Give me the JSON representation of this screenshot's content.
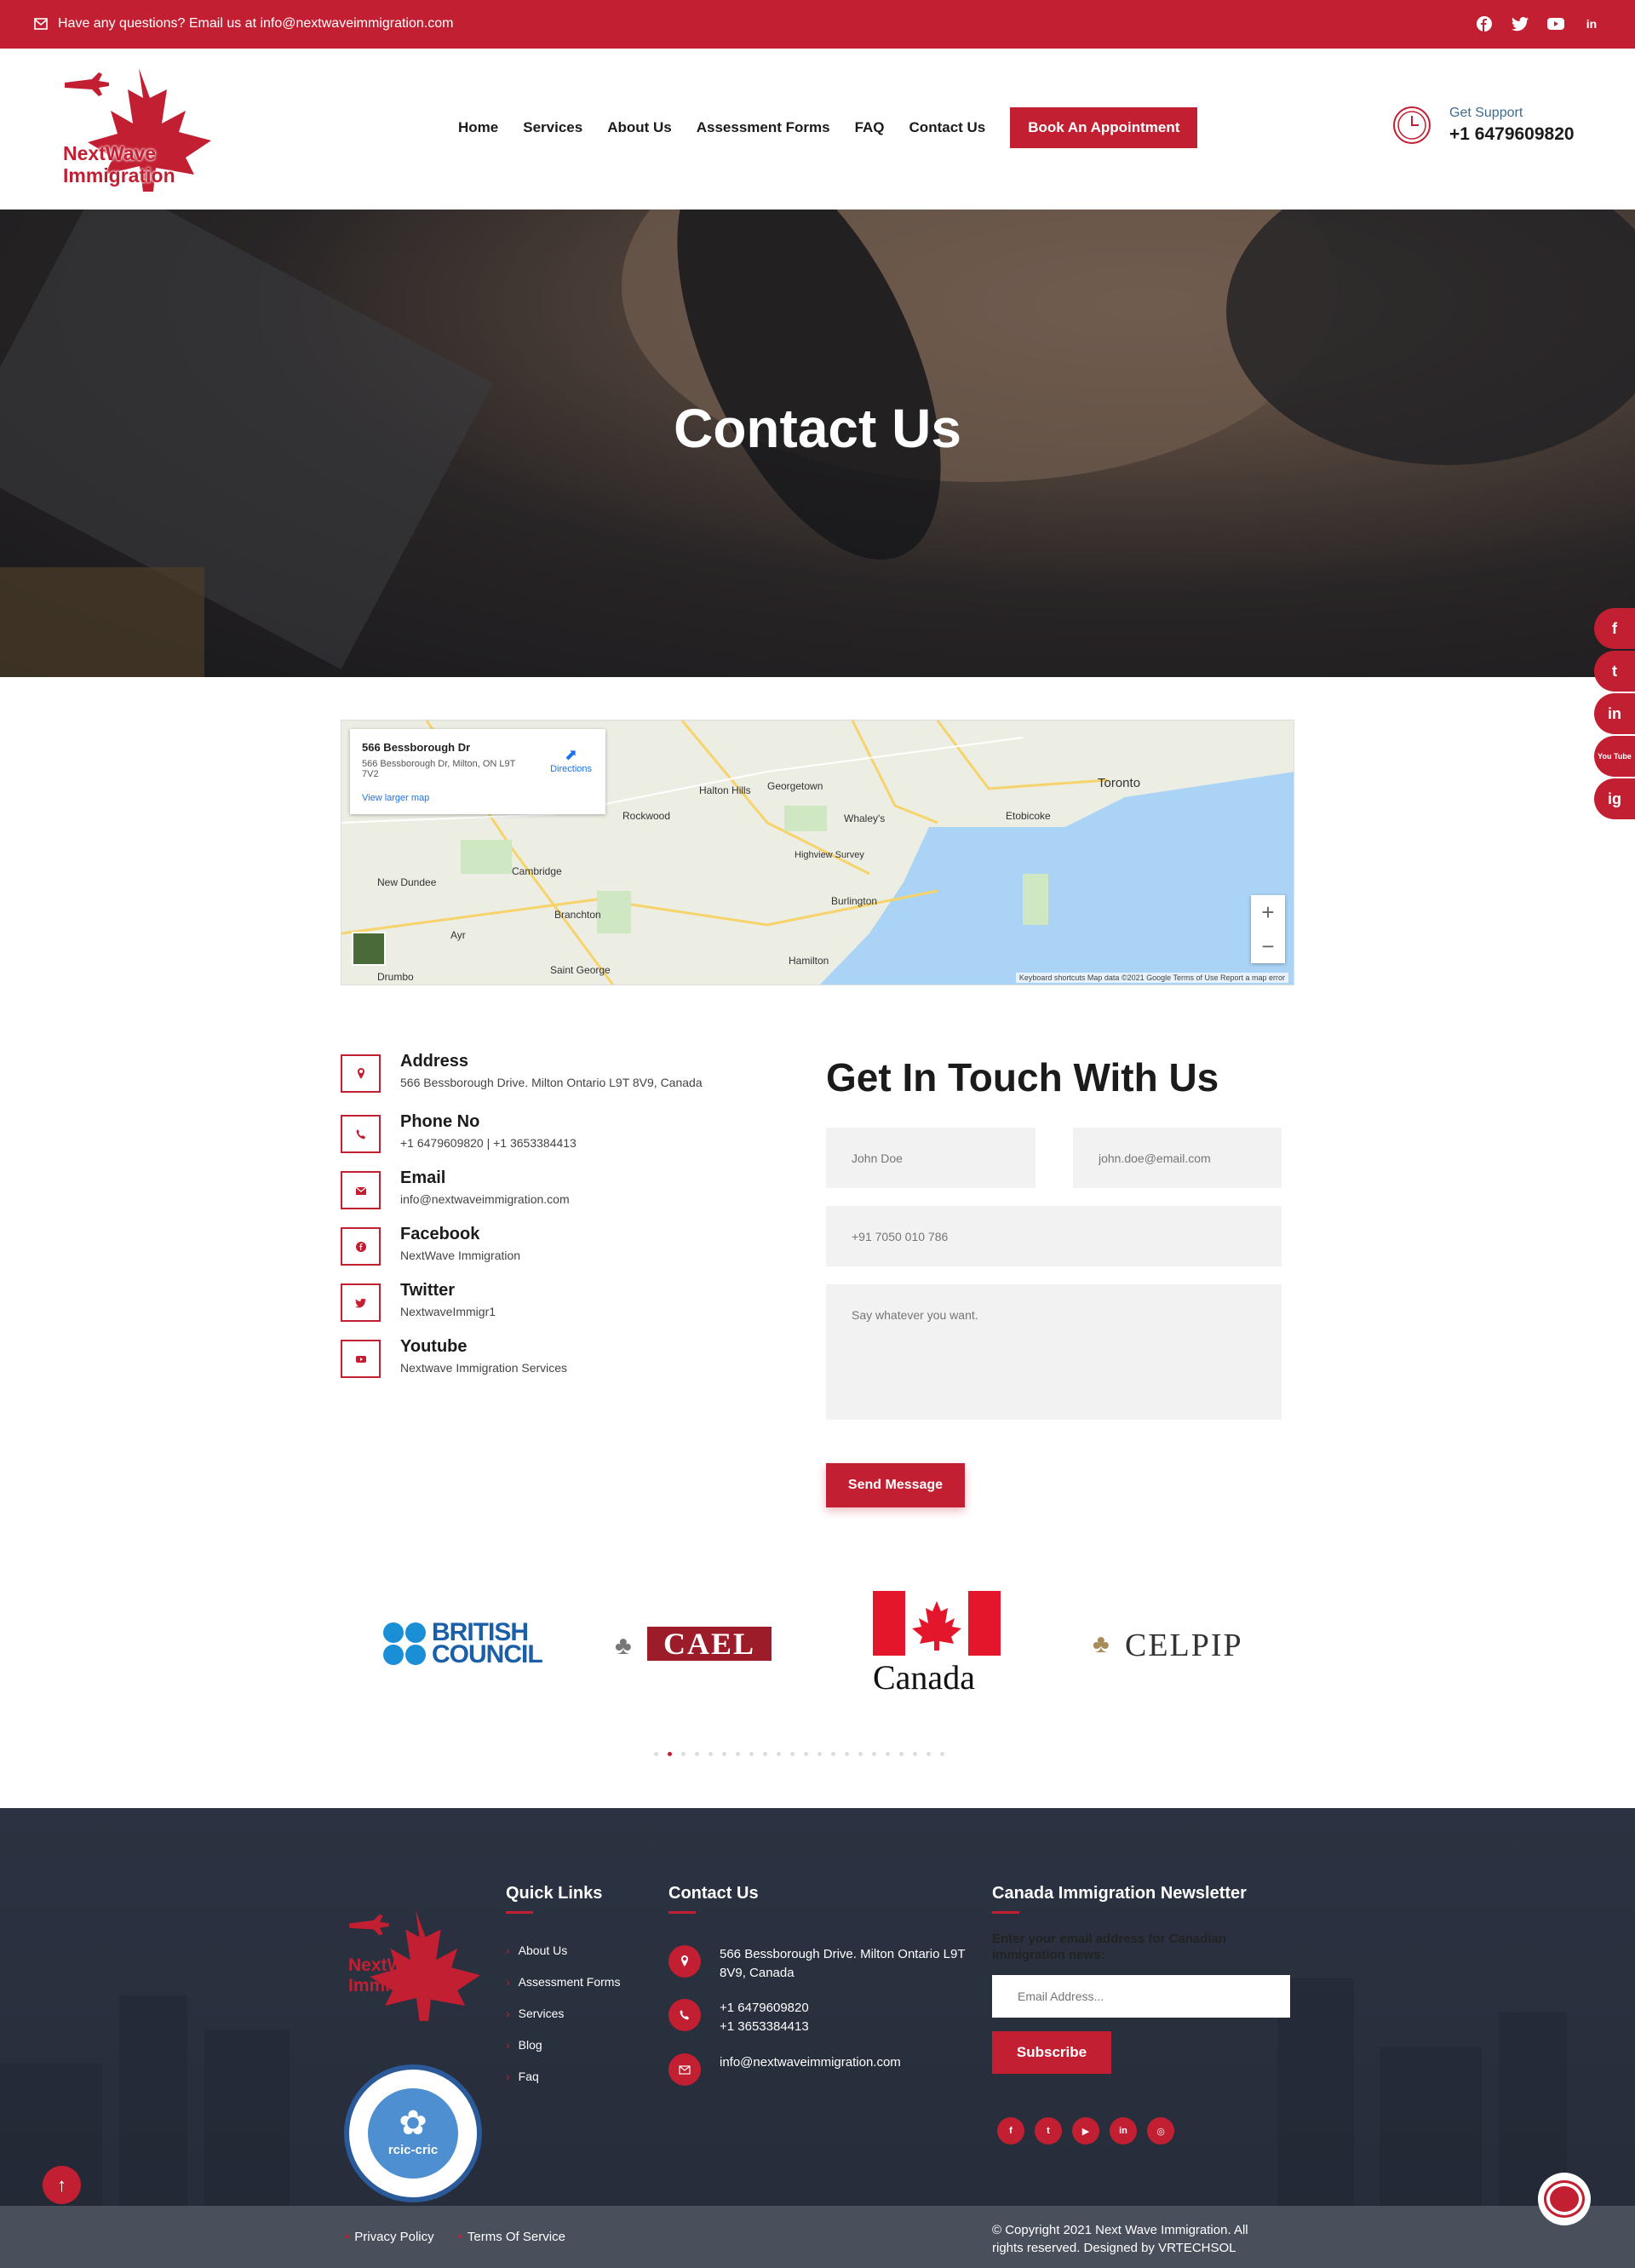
{
  "topbar": {
    "email_text": "Have any questions? Email us at info@nextwaveimmigration.com",
    "social_icons": [
      "facebook-icon",
      "twitter-icon",
      "youtube-icon",
      "linkedin-icon"
    ]
  },
  "header": {
    "logo_line1": "NextWave",
    "logo_line2": "Immigration",
    "nav": [
      "Home",
      "Services",
      "About Us",
      "Assessment Forms",
      "FAQ",
      "Contact Us"
    ],
    "cta": "Book An Appointment",
    "support_label": "Get Support",
    "support_number": "+1 6479609820"
  },
  "hero": {
    "title": "Contact Us"
  },
  "map": {
    "place_title": "566 Bessborough Dr",
    "place_address": "566 Bessborough Dr, Milton, ON L9T 7V2",
    "directions": "Directions",
    "larger_map": "View larger map",
    "cities": [
      "Toronto",
      "Burlington",
      "Cambridge",
      "Halton Hills",
      "Brampton",
      "Etobicoke",
      "Hamilton",
      "New Dundee",
      "Rockwood",
      "Whaley's",
      "Georgetown",
      "Ayr",
      "Branchton",
      "Saint George",
      "Drumbo",
      "Highview Survey"
    ],
    "footer_text": "Keyboard shortcuts   Map data ©2021 Google   Terms of Use   Report a map error"
  },
  "contact": {
    "items": [
      {
        "label": "Address",
        "value": "566 Bessborough Drive. Milton Ontario L9T 8V9, Canada",
        "icon": "location-icon"
      },
      {
        "label": "Phone No",
        "value": "+1 6479609820 | +1 3653384413",
        "icon": "phone-icon"
      },
      {
        "label": "Email",
        "value": "info@nextwaveimmigration.com",
        "icon": "envelope-icon"
      },
      {
        "label": "Facebook",
        "value": "NextWave Immigration",
        "icon": "facebook-icon"
      },
      {
        "label": "Twitter",
        "value": "NextwaveImmigr1",
        "icon": "twitter-icon"
      },
      {
        "label": "Youtube",
        "value": "Nextwave Immigration Services",
        "icon": "youtube-icon"
      }
    ]
  },
  "form": {
    "title": "Get In Touch With Us",
    "name_placeholder": "John Doe",
    "email_placeholder": "john.doe@email.com",
    "phone_placeholder": "+91 7050 010 786",
    "message_placeholder": "Say whatever you want.",
    "submit": "Send Message"
  },
  "partners": {
    "british_council_1": "BRITISH",
    "british_council_2": "COUNCIL",
    "cael": "CAEL",
    "canada": "Canada",
    "celpip": "CELPIP",
    "dots_count": 22,
    "active_dot": 1
  },
  "side_socials": [
    "f",
    "t",
    "in",
    "You Tube",
    "ig"
  ],
  "footer": {
    "quick_links_title": "Quick Links",
    "quick_links": [
      "About Us",
      "Assessment Forms",
      "Services",
      "Blog",
      "Faq"
    ],
    "contact_title": "Contact Us",
    "contact_address": "566 Bessborough Drive. Milton Ontario L9T 8V9, Canada",
    "contact_phone1": "+1 6479609820",
    "contact_phone2": "+1 3653384413",
    "contact_email": "info@nextwaveimmigration.com",
    "newsletter_title": "Canada Immigration Newsletter",
    "newsletter_sub": "Enter your email address for Canadian immigration news:",
    "email_placeholder": "Email Address...",
    "subscribe": "Subscribe",
    "badge_text": "rcic-cric",
    "privacy": "Privacy Policy",
    "terms": "Terms Of Service",
    "copyright": "© Copyright 2021 Next Wave Immigration. All rights reserved. Designed by VRTECHSOL"
  },
  "colors": {
    "brand_red": "#c21f32",
    "footer_bg": "#2b3241"
  }
}
